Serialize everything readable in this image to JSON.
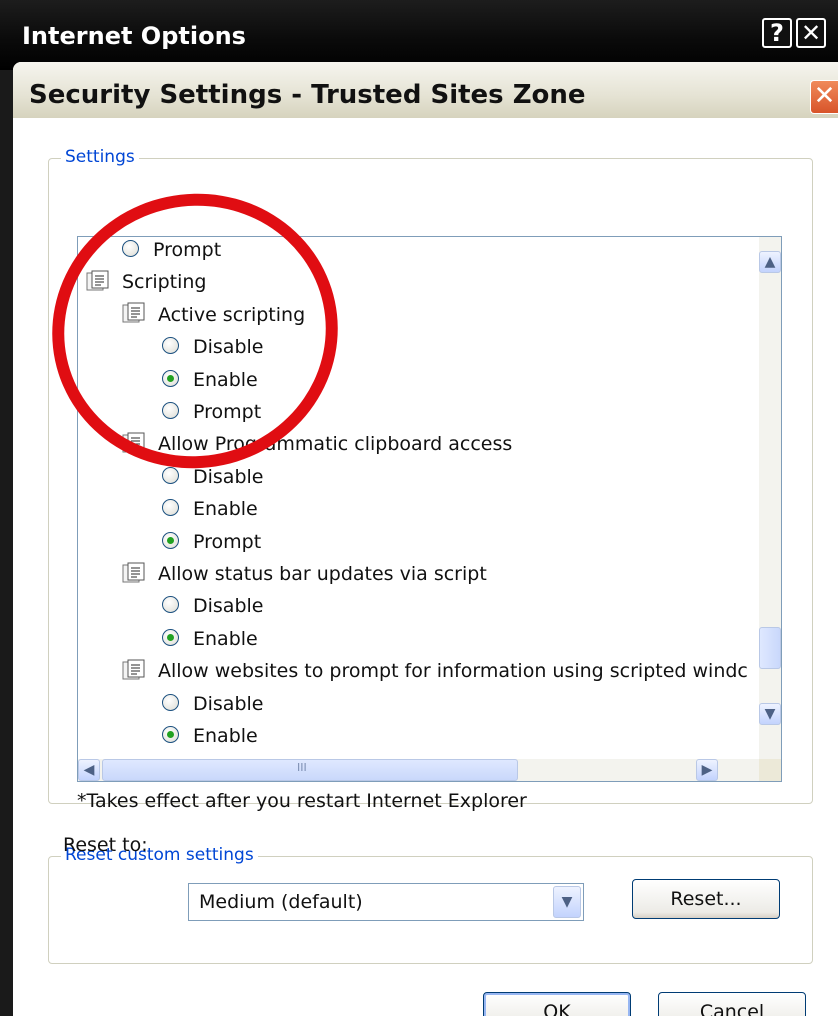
{
  "outer_window": {
    "title": "Internet Options",
    "help_label": "?",
    "close_label": "✕"
  },
  "dialog": {
    "title": "Security Settings - Trusted Sites Zone",
    "close_label": "✕"
  },
  "settings_group": {
    "label": "Settings",
    "rows": [
      {
        "kind": "radio",
        "label": "Prompt",
        "checked": false,
        "indent": 1
      },
      {
        "kind": "category",
        "label": "Scripting",
        "indent": 0
      },
      {
        "kind": "setting",
        "label": "Active scripting",
        "indent": 1
      },
      {
        "kind": "radio",
        "label": "Disable",
        "checked": false,
        "indent": 2
      },
      {
        "kind": "radio",
        "label": "Enable",
        "checked": true,
        "indent": 2
      },
      {
        "kind": "radio",
        "label": "Prompt",
        "checked": false,
        "indent": 2
      },
      {
        "kind": "setting",
        "label": "Allow Programmatic clipboard access",
        "indent": 1
      },
      {
        "kind": "radio",
        "label": "Disable",
        "checked": false,
        "indent": 2
      },
      {
        "kind": "radio",
        "label": "Enable",
        "checked": false,
        "indent": 2
      },
      {
        "kind": "radio",
        "label": "Prompt",
        "checked": true,
        "indent": 2
      },
      {
        "kind": "setting",
        "label": "Allow status bar updates via script",
        "indent": 1
      },
      {
        "kind": "radio",
        "label": "Disable",
        "checked": false,
        "indent": 2
      },
      {
        "kind": "radio",
        "label": "Enable",
        "checked": true,
        "indent": 2
      },
      {
        "kind": "setting",
        "label": "Allow websites to prompt for information using scripted windc",
        "indent": 1
      },
      {
        "kind": "radio",
        "label": "Disable",
        "checked": false,
        "indent": 2
      },
      {
        "kind": "radio",
        "label": "Enable",
        "checked": true,
        "indent": 2
      }
    ],
    "note": "*Takes effect after you restart Internet Explorer"
  },
  "reset_group": {
    "label": "Reset custom settings",
    "reset_to_label": "Reset to:",
    "reset_to_value": "Medium (default)",
    "reset_button_label": "Reset..."
  },
  "footer": {
    "ok_label": "OK",
    "cancel_label": "Cancel"
  },
  "scrollbar": {
    "hthumb_grip": "III"
  },
  "colors": {
    "highlight_circle": "#e00d12",
    "group_label": "#0046d5",
    "radio_checked": "#21a121"
  }
}
